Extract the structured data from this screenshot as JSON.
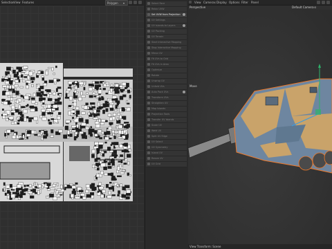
{
  "uv_editor": {
    "menu": [
      "Selection",
      "View",
      "Features"
    ],
    "mode_value": "Polygon"
  },
  "command_panel": {
    "items": [
      {
        "label": "Select Face"
      },
      {
        "label": "Relax UVW"
      },
      {
        "label": "Set UVW from Projection",
        "active": true,
        "badge": true
      },
      {
        "label": "UV Settings"
      },
      {
        "label": "UV Islands to Layers",
        "badge": true
      },
      {
        "label": "UV Packing"
      },
      {
        "label": "UV Terrain"
      },
      {
        "label": "Start Interactive Mapping"
      },
      {
        "label": "Stop Interactive Mapping"
      },
      {
        "label": "Mirror UV"
      },
      {
        "label": "Fit UVs to Grid"
      },
      {
        "label": "Fit UVs in Area"
      },
      {
        "label": "Optimize"
      },
      {
        "label": "Rotate"
      },
      {
        "label": "Unwrap UV"
      },
      {
        "label": "Unfold UVs"
      },
      {
        "label": "Auto Pack UVs",
        "badge": true
      },
      {
        "label": "Transform UVs"
      },
      {
        "label": "Straighten UV"
      },
      {
        "label": "Map Islands"
      },
      {
        "label": "Projection Tools"
      },
      {
        "label": "Transfer UV Islands"
      },
      {
        "label": "Scale UV"
      },
      {
        "label": "Weld UV"
      },
      {
        "label": "Split UV Edge"
      },
      {
        "label": "UV Select"
      },
      {
        "label": "UV Symmetry"
      },
      {
        "label": "Island UV"
      },
      {
        "label": "Resize UV"
      },
      {
        "label": "UV Grid"
      }
    ]
  },
  "viewport": {
    "menu": [
      "View",
      "Cameras",
      "Display",
      "Options",
      "Filter",
      "Panel"
    ],
    "view_name": "Perspective",
    "camera_name": "Default Camera",
    "move_label": "Move",
    "status_text": "View Transform: Scene"
  },
  "colors": {
    "panel_bg": "#2e2e2e",
    "tan_camo": "#c9a36a",
    "blue_camo": "#6e86a0",
    "orange_outline": "#f07a2a"
  }
}
